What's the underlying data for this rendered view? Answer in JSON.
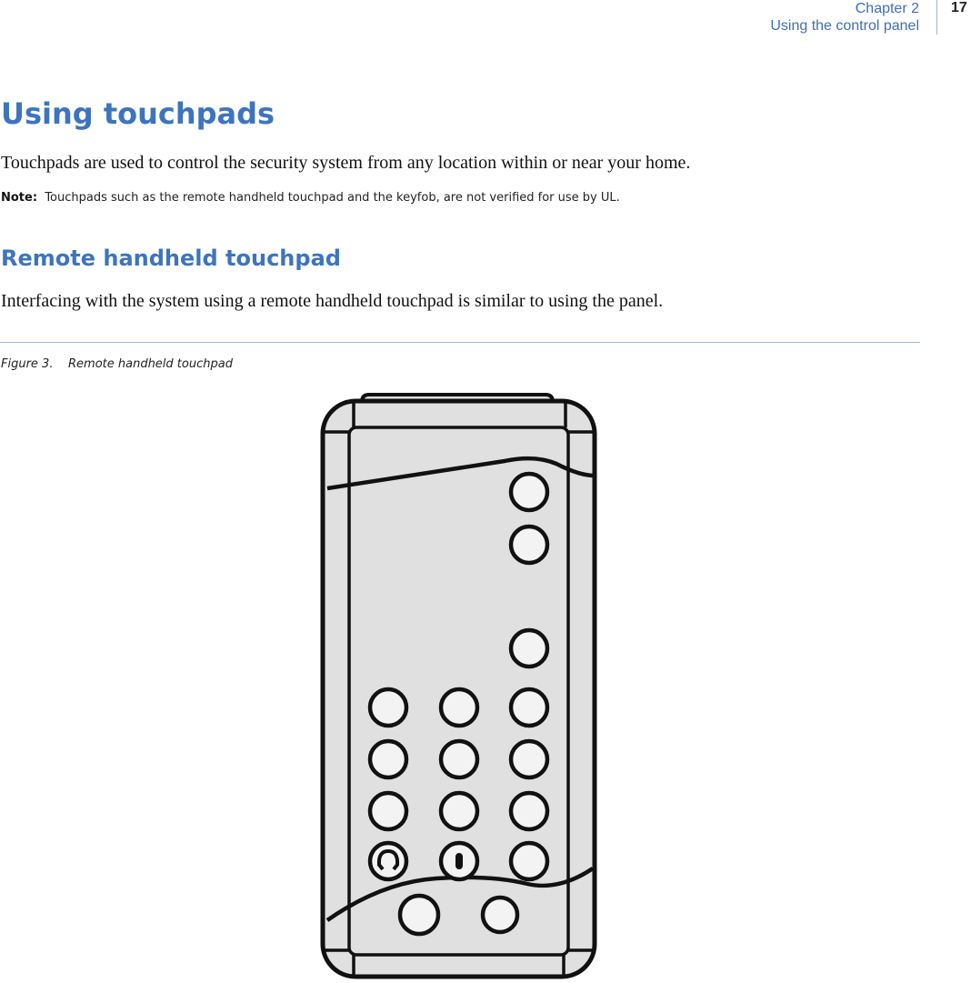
{
  "header": {
    "chapter": "Chapter 2",
    "section": "Using the control panel",
    "page_number": "17"
  },
  "content": {
    "title": "Using touchpads",
    "intro": "Touchpads are used to control the security system from any location within or near your home.",
    "note_label": "Note:",
    "note_text": "Touchpads such as the remote handheld touchpad and the keyfob, are not verified for use by UL.",
    "subtitle": "Remote handheld touchpad",
    "subtitle_body": "Interfacing with the system using a remote handheld touchpad is similar to using the panel."
  },
  "figure": {
    "caption_number": "Figure 3.",
    "caption_text": "Remote handheld touchpad",
    "device": {
      "body_color": "#e0e0e0",
      "button_color": "#f3f3f3",
      "outline_color": "#111111",
      "buttons": [
        {
          "name": "top-button-1",
          "icon": null
        },
        {
          "name": "top-button-2",
          "icon": null
        },
        {
          "name": "top-button-3",
          "icon": null
        },
        {
          "name": "keypad-1",
          "icon": null
        },
        {
          "name": "keypad-2",
          "icon": null
        },
        {
          "name": "keypad-3",
          "icon": null
        },
        {
          "name": "keypad-4",
          "icon": null
        },
        {
          "name": "keypad-5",
          "icon": null
        },
        {
          "name": "keypad-6",
          "icon": null
        },
        {
          "name": "keypad-7",
          "icon": null
        },
        {
          "name": "keypad-8",
          "icon": null
        },
        {
          "name": "keypad-9",
          "icon": null
        },
        {
          "name": "bypass-button",
          "icon": "horseshoe-icon"
        },
        {
          "name": "zero-button",
          "icon": "zero-icon"
        },
        {
          "name": "keypad-right-bottom",
          "icon": null
        },
        {
          "name": "bottom-button-left",
          "icon": null
        },
        {
          "name": "bottom-button-right",
          "icon": null
        }
      ]
    }
  }
}
